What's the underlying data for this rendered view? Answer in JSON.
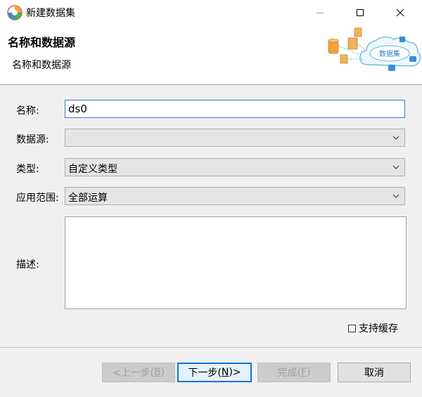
{
  "window": {
    "title": "新建数据集",
    "min_icon": "minimize-icon",
    "max_icon": "maximize-icon",
    "close_icon": "close-icon"
  },
  "banner": {
    "title": "名称和数据源",
    "subtitle": "名称和数据源",
    "art_label": "数据集"
  },
  "form": {
    "name_label": "名称:",
    "name_value": "ds0",
    "datasource_label": "数据源:",
    "datasource_value": "",
    "type_label": "类型:",
    "type_value": "自定义类型",
    "scope_label": "应用范围:",
    "scope_value": "全部运算",
    "desc_label": "描述:",
    "desc_value": ""
  },
  "cache": {
    "label": "支持缓存",
    "checked": false
  },
  "buttons": {
    "prev": {
      "text": "<上一步(",
      "key": "B",
      "tail": ")"
    },
    "next": {
      "text": "下一步(",
      "key": "N",
      "tail": ")>"
    },
    "finish": {
      "text": "完成(",
      "key": "F",
      "tail": ")"
    },
    "cancel": "取消"
  },
  "colors": {
    "accent": "#0078d7",
    "focus_border": "#3b7ad0",
    "window_bg": "#f0f0f0"
  }
}
